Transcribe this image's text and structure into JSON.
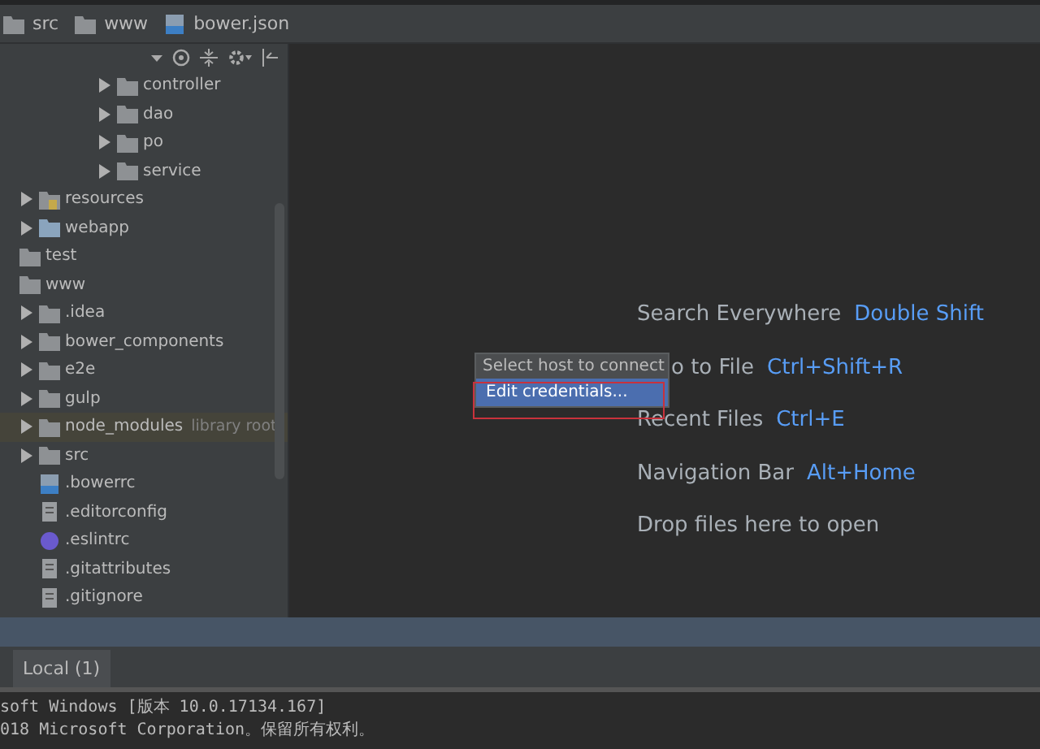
{
  "breadcrumbs": [
    {
      "label": "src",
      "kind": "folder"
    },
    {
      "label": "www",
      "kind": "folder"
    },
    {
      "label": "bower.json",
      "kind": "bower"
    }
  ],
  "project_tree": {
    "open_branch": [
      {
        "label": "controller",
        "kind": "folder",
        "expanded": false
      },
      {
        "label": "dao",
        "kind": "folder",
        "expanded": false
      },
      {
        "label": "po",
        "kind": "folder",
        "expanded": false
      },
      {
        "label": "service",
        "kind": "folder",
        "expanded": false
      }
    ],
    "branch_siblings": [
      {
        "label": "resources",
        "kind": "resources",
        "expanded": false
      },
      {
        "label": "webapp",
        "kind": "web",
        "expanded": false
      }
    ],
    "roots": [
      {
        "label": "test",
        "kind": "folder"
      },
      {
        "label": "www",
        "kind": "folder",
        "children": [
          {
            "label": ".idea",
            "kind": "folder",
            "expanded": false
          },
          {
            "label": "bower_components",
            "kind": "folder",
            "expanded": false
          },
          {
            "label": "e2e",
            "kind": "folder",
            "expanded": false
          },
          {
            "label": "gulp",
            "kind": "folder",
            "expanded": false
          },
          {
            "label": "node_modules",
            "kind": "folder",
            "expanded": false,
            "tag": "library root"
          },
          {
            "label": "src",
            "kind": "folder",
            "expanded": false
          },
          {
            "label": ".bowerrc",
            "kind": "bower"
          },
          {
            "label": ".editorconfig",
            "kind": "file"
          },
          {
            "label": ".eslintrc",
            "kind": "eslint"
          },
          {
            "label": ".gitattributes",
            "kind": "file"
          },
          {
            "label": ".gitignore",
            "kind": "file"
          }
        ]
      }
    ]
  },
  "editor_hints": [
    {
      "action": "Search Everywhere",
      "shortcut": "Double Shift",
      "kind": "plain"
    },
    {
      "action": "o to File",
      "shortcut": "Ctrl+Shift+R",
      "kind": "partly-covered"
    },
    {
      "action": "Recent Files",
      "shortcut": "Ctrl+E",
      "kind": "plain"
    },
    {
      "action": "Navigation Bar",
      "shortcut": "Alt+Home",
      "kind": "plain"
    },
    {
      "action": "Drop files here to open",
      "kind": "plain"
    }
  ],
  "host_popup": {
    "title": "Select host to connect",
    "items": [
      {
        "label": "Edit credentials...",
        "selected": true
      }
    ]
  },
  "terminal_tabs": [
    {
      "label": "Local (1)",
      "selected": true
    }
  ],
  "terminal_lines": [
    "soft Windows [版本 10.0.17134.167]",
    "018 Microsoft Corporation。保留所有权利。"
  ]
}
